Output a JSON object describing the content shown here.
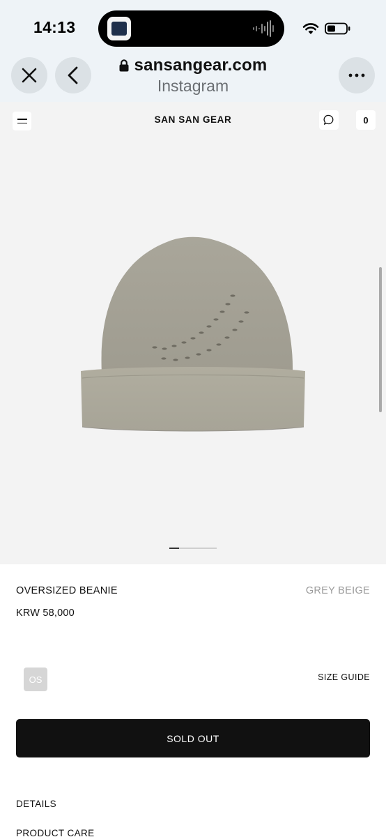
{
  "status_bar": {
    "time": "14:13",
    "icons": [
      "island-app-icon",
      "audio-wave-icon",
      "wifi-icon",
      "battery-icon"
    ]
  },
  "browser": {
    "url": "sansangear.com",
    "source": "Instagram",
    "icons": [
      "close-icon",
      "back-chevron-icon",
      "lock-icon",
      "more-icon"
    ]
  },
  "site": {
    "brand": "SAN SAN GEAR",
    "cart_count": "0",
    "icons": [
      "menu-icon",
      "chat-bubble-icon"
    ]
  },
  "gallery": {
    "image": "grey beige knit beanie with perforated swoosh",
    "slide_index": 1
  },
  "product": {
    "name": "OVERSIZED BEANIE",
    "color": "GREY BEIGE",
    "price": "KRW 58,000",
    "size_option": "OS",
    "size_guide": "SIZE GUIDE",
    "button": "SOLD OUT"
  },
  "sections": {
    "details": "DETAILS",
    "product_care": "PRODUCT CARE"
  },
  "colors": {
    "chrome_bg": "#eef3f7",
    "page_bg": "#f3f3f3",
    "button_bg": "#111111",
    "muted_text": "#9a9a9a",
    "beanie": "#a8a598"
  }
}
